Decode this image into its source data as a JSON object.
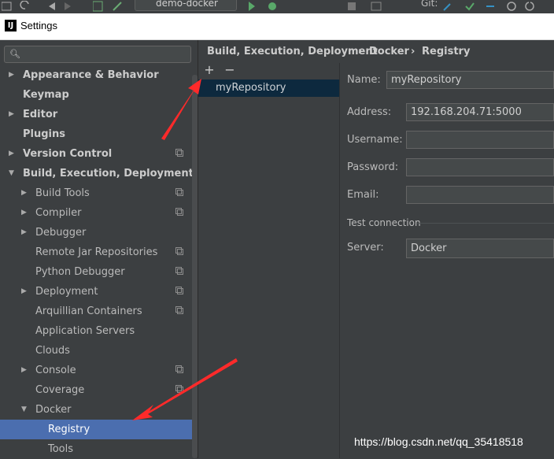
{
  "toolbar": {
    "project": "demo-docker",
    "git_label": "Git:"
  },
  "window": {
    "title": "Settings"
  },
  "search": {
    "placeholder": ""
  },
  "tree": {
    "items": [
      {
        "label": "Appearance & Behavior",
        "bold": true,
        "arrow": "right"
      },
      {
        "label": "Keymap",
        "bold": true,
        "arrow": ""
      },
      {
        "label": "Editor",
        "bold": true,
        "arrow": "right"
      },
      {
        "label": "Plugins",
        "bold": true,
        "arrow": ""
      },
      {
        "label": "Version Control",
        "bold": true,
        "arrow": "right"
      },
      {
        "label": "Build, Execution, Deployment",
        "bold": true,
        "arrow": "down"
      },
      {
        "label": "Build Tools",
        "arrow": "right"
      },
      {
        "label": "Compiler",
        "arrow": "right"
      },
      {
        "label": "Debugger",
        "arrow": "right"
      },
      {
        "label": "Remote Jar Repositories",
        "arrow": ""
      },
      {
        "label": "Python Debugger",
        "arrow": ""
      },
      {
        "label": "Deployment",
        "arrow": "right"
      },
      {
        "label": "Arquillian Containers",
        "arrow": ""
      },
      {
        "label": "Application Servers",
        "arrow": ""
      },
      {
        "label": "Clouds",
        "arrow": ""
      },
      {
        "label": "Console",
        "arrow": "right"
      },
      {
        "label": "Coverage",
        "arrow": ""
      },
      {
        "label": "Docker",
        "arrow": "down"
      },
      {
        "label": "Registry",
        "arrow": "",
        "selected": true
      },
      {
        "label": "Tools",
        "arrow": ""
      }
    ]
  },
  "breadcrumb": {
    "part1": "Build, Execution, Deployment",
    "sep": "›",
    "part2": "Docker",
    "part3": "Registry"
  },
  "list": {
    "add": "+",
    "remove": "−",
    "items": [
      "myRepository"
    ]
  },
  "form": {
    "name_label": "Name:",
    "name_value": "myRepository",
    "address_label": "Address:",
    "address_value": "192.168.204.71:5000",
    "username_label": "Username:",
    "username_value": "",
    "password_label": "Password:",
    "password_value": "",
    "email_label": "Email:",
    "email_value": "",
    "test_connection": "Test connection",
    "server_label": "Server:",
    "server_value": "Docker"
  },
  "watermark": "https://blog.csdn.net/qq_35418518",
  "colors": {
    "selection": "#4b6eaf",
    "list_selection": "#0d293e",
    "annotation_arrow": "#ff2a2a"
  }
}
